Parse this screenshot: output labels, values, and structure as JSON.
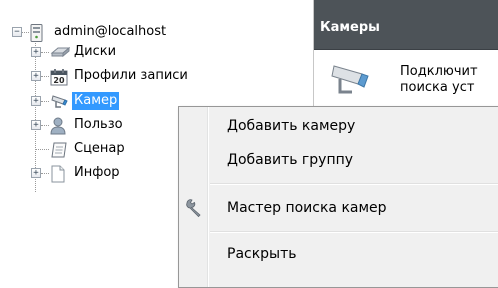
{
  "tree": {
    "root": "admin@localhost",
    "items": [
      {
        "label": "Диски",
        "icon": "disk-icon"
      },
      {
        "label": "Профили записи",
        "icon": "calendar-icon",
        "icon_text": "20"
      },
      {
        "label": "Камеры",
        "icon": "camera-icon",
        "selected": true
      },
      {
        "label": "Пользователи",
        "icon": "user-icon"
      },
      {
        "label": "Сценарии",
        "icon": "script-icon"
      },
      {
        "label": "Информация",
        "icon": "document-icon"
      }
    ],
    "visible_labels": [
      "Диски",
      "Профили записи",
      "Камер",
      "Пользо",
      "Сценар",
      "Инфор"
    ]
  },
  "panel": {
    "title": "Камеры",
    "text": "Подключит\nпоиска уст"
  },
  "context_menu": {
    "items": [
      {
        "label": "Добавить камеру"
      },
      {
        "label": "Добавить группу"
      },
      {
        "label": "Мастер поиска камер",
        "icon": "wrench-icon"
      },
      {
        "label": "Раскрыть"
      }
    ]
  },
  "colors": {
    "selection": "#3399ff",
    "panel_header": "#4d5358",
    "menu_bg": "#f0f0f0"
  }
}
